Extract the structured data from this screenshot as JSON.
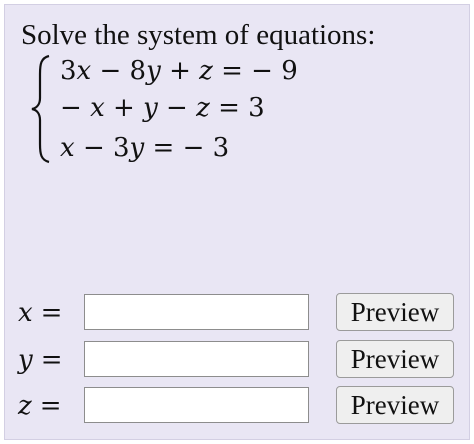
{
  "question": {
    "prompt": "Solve the system of equations:",
    "equations": [
      {
        "a": "3",
        "v1": "x",
        "op1": "−",
        "b": "8",
        "v2": "y",
        "op2": "+",
        "v3": "z",
        "rhs": "− 9"
      },
      {
        "a": "−",
        "v1": "x",
        "op1": "+",
        "v2": "y",
        "op2": "−",
        "v3": "z",
        "rhs": "3"
      },
      {
        "v1": "x",
        "op1": "−",
        "b": "3",
        "v2": "y",
        "rhs": "− 3"
      }
    ]
  },
  "answers": [
    {
      "variable": "x",
      "equals": "=",
      "value": "",
      "button_label": "Preview"
    },
    {
      "variable": "y",
      "equals": "=",
      "value": "",
      "button_label": "Preview"
    },
    {
      "variable": "z",
      "equals": "=",
      "value": "",
      "button_label": "Preview"
    }
  ]
}
